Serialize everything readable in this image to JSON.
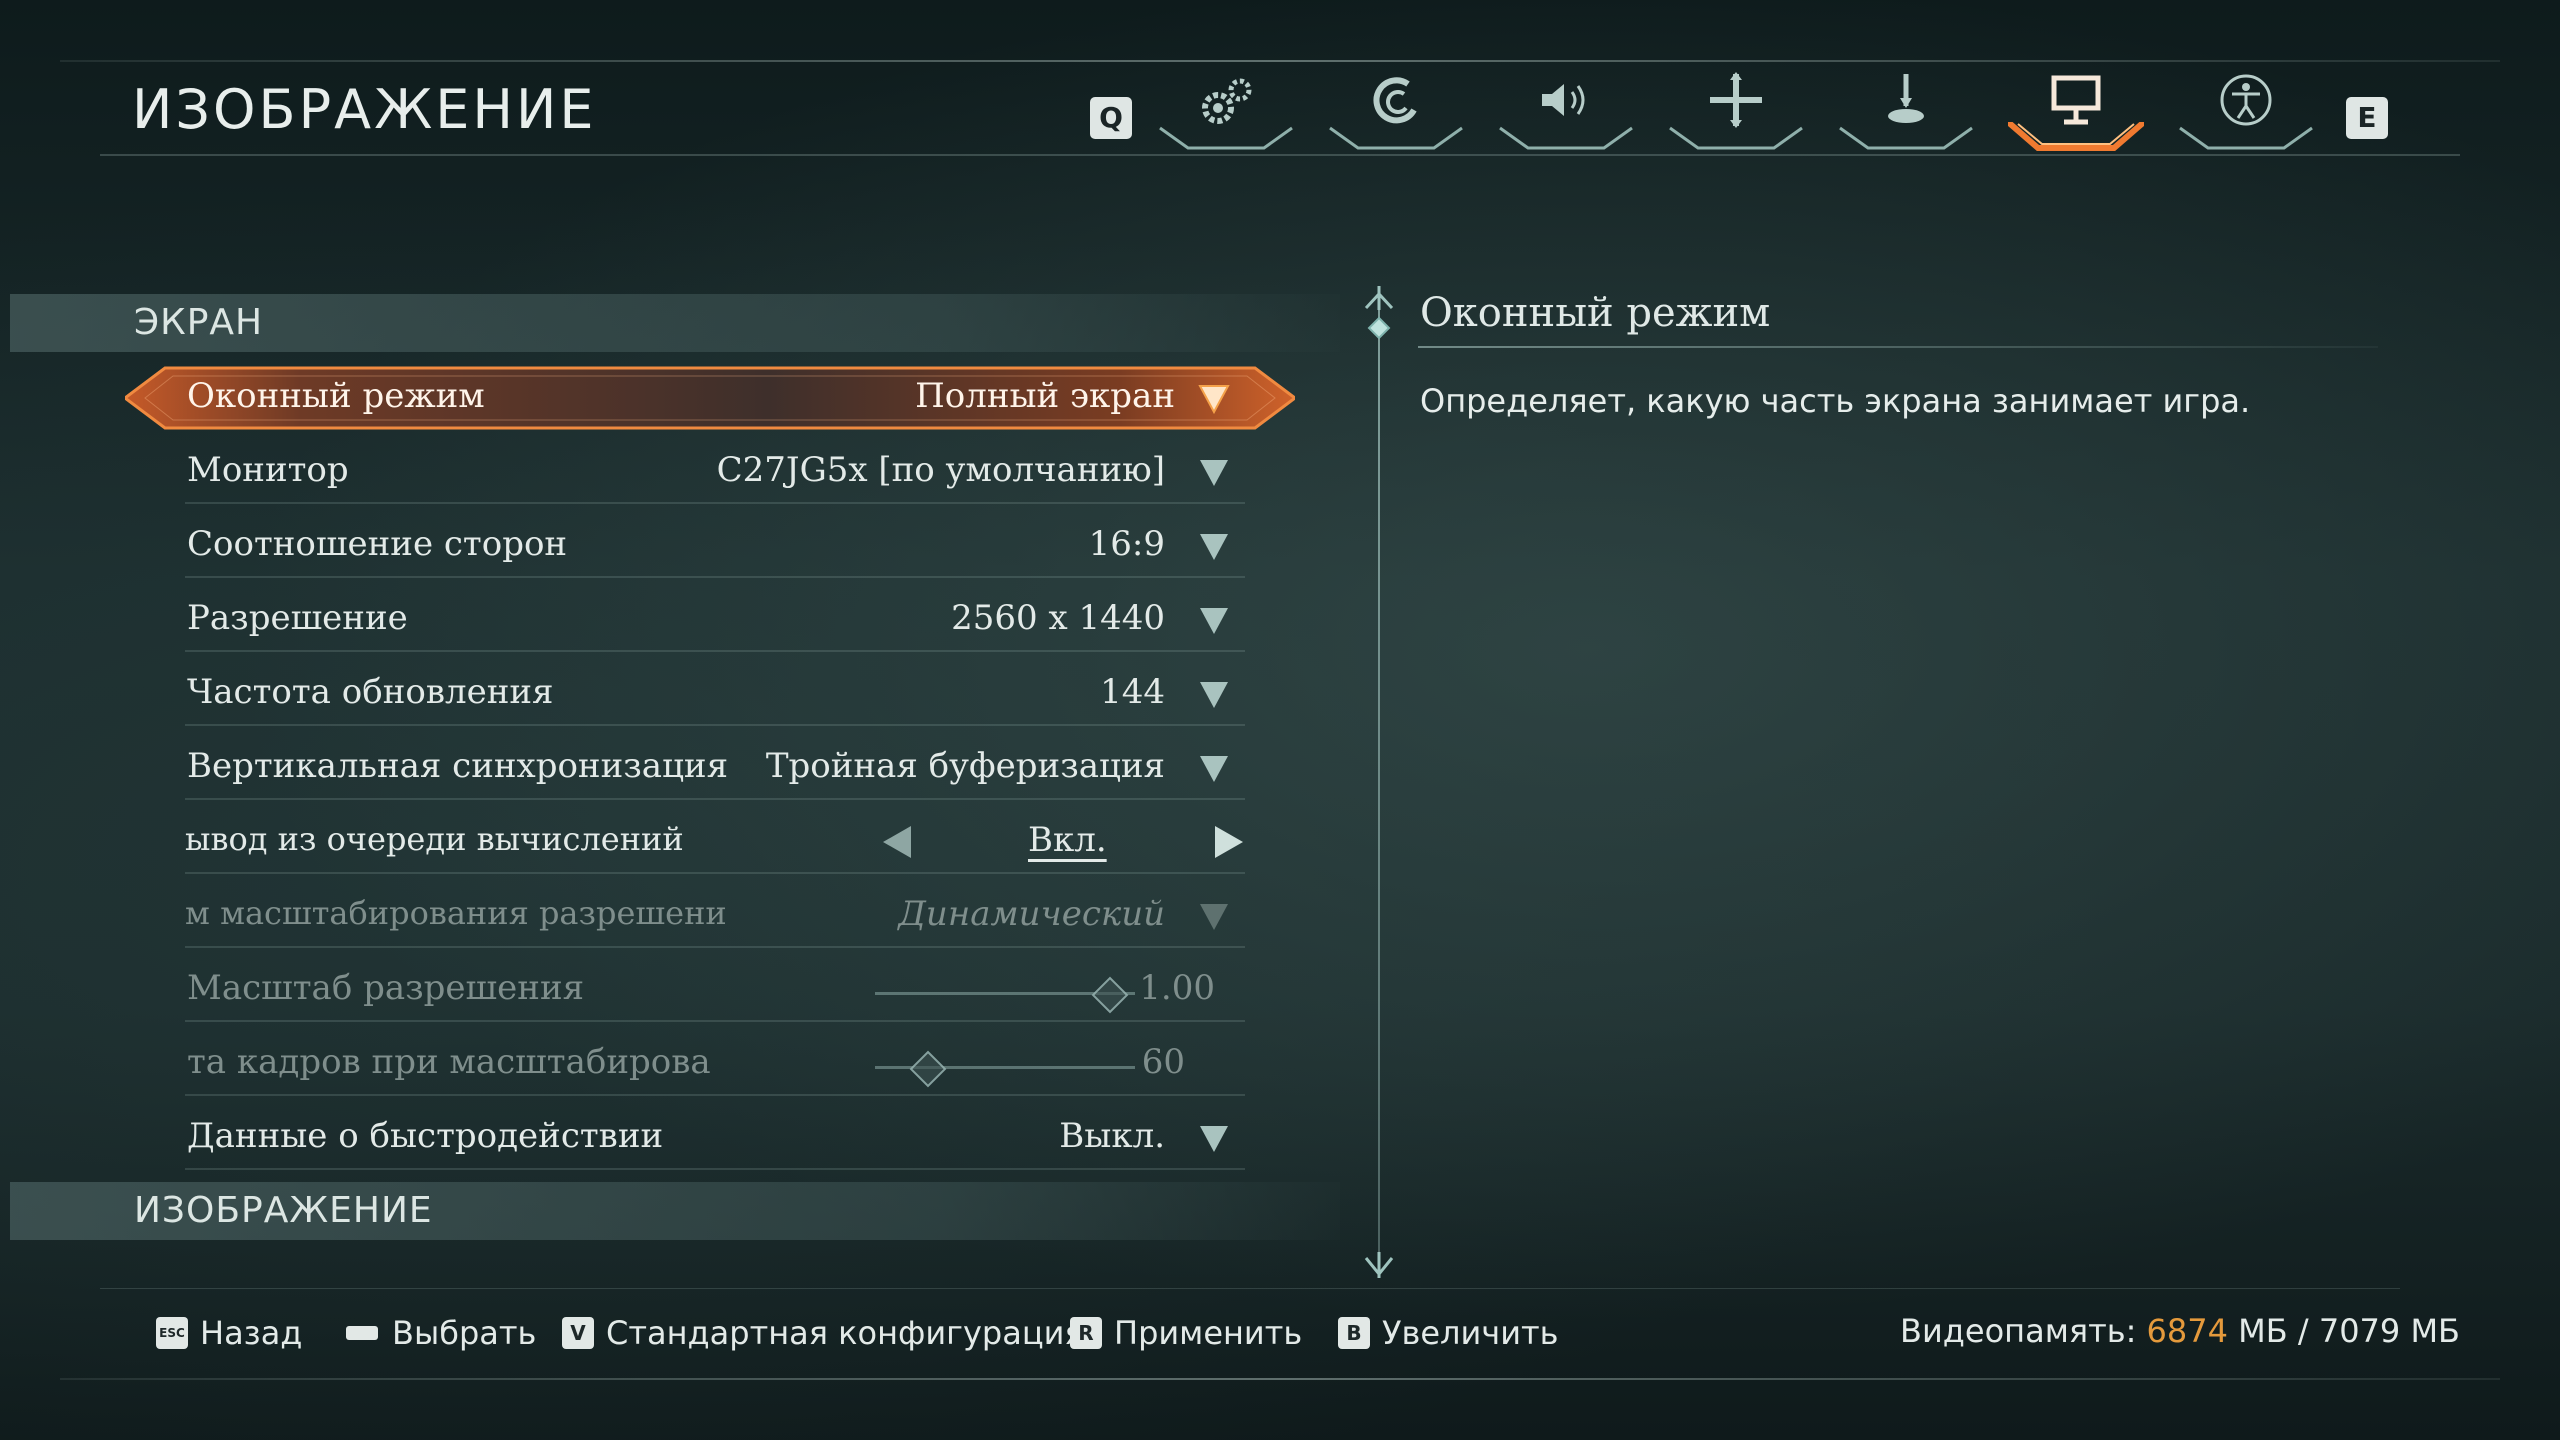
{
  "header": {
    "title": "ИЗОБРАЖЕНИЕ",
    "prev_key": "Q",
    "next_key": "E",
    "tabs": [
      {
        "name": "tab-game",
        "icon": "gears-icon",
        "active": false
      },
      {
        "name": "tab-controls",
        "icon": "swirl-icon",
        "active": false
      },
      {
        "name": "tab-audio",
        "icon": "speaker-icon",
        "active": false
      },
      {
        "name": "tab-interface",
        "icon": "crosshair-icon",
        "active": false
      },
      {
        "name": "tab-controller",
        "icon": "joystick-icon",
        "active": false
      },
      {
        "name": "tab-display",
        "icon": "monitor-icon",
        "active": true
      },
      {
        "name": "tab-accessibility",
        "icon": "accessibility-icon",
        "active": false
      }
    ]
  },
  "sections": {
    "screen": "ЭКРАН",
    "image": "ИЗОБРАЖЕНИЕ"
  },
  "settings": [
    {
      "label": "Оконный режим",
      "value": "Полный экран",
      "control": "dropdown",
      "state": "active"
    },
    {
      "label": "Монитор",
      "value": "C27JG5x [по умолчанию]",
      "control": "dropdown",
      "state": "normal"
    },
    {
      "label": "Соотношение сторон",
      "value": "16:9",
      "control": "dropdown",
      "state": "normal"
    },
    {
      "label": "Разрешение",
      "value": "2560 x 1440",
      "control": "dropdown",
      "state": "normal"
    },
    {
      "label": "Частота обновления",
      "value": "144",
      "control": "dropdown",
      "state": "normal"
    },
    {
      "label": "Вертикальная синхронизация",
      "value": "Тройная буферизация",
      "control": "dropdown",
      "state": "normal"
    },
    {
      "label": "ывод из очереди вычислений",
      "value": "Вкл.",
      "control": "toggle",
      "state": "normal"
    },
    {
      "label": "м масштабирования разрешени",
      "value": "Динамический",
      "control": "dropdown",
      "state": "disabled"
    },
    {
      "label": "Масштаб разрешения",
      "value": "1.00",
      "control": "slider",
      "state": "disabled",
      "level": 0.9
    },
    {
      "label": "та кадров при масштабирова",
      "value": "60",
      "control": "slider",
      "state": "disabled",
      "level": 0.2
    },
    {
      "label": "Данные о быстродействии",
      "value": "Выкл.",
      "control": "dropdown",
      "state": "normal"
    }
  ],
  "description": {
    "title": "Оконный режим",
    "text": "Определяет, какую часть экрана занимает игра."
  },
  "footer": {
    "hints": [
      {
        "key": "ESC",
        "label": "Назад"
      },
      {
        "key": "▬",
        "label": "Выбрать"
      },
      {
        "key": "V",
        "label": "Стандартная конфигурация"
      },
      {
        "key": "R",
        "label": "Применить"
      },
      {
        "key": "B",
        "label": "Увеличить"
      }
    ],
    "vram_label": "Видеопамять:",
    "vram_used": "6874",
    "vram_rest": "МБ / 7079 МБ"
  },
  "colors": {
    "accent": "#e8742e",
    "vram_used": "#e59a3c",
    "background": "#1b2c2d"
  }
}
